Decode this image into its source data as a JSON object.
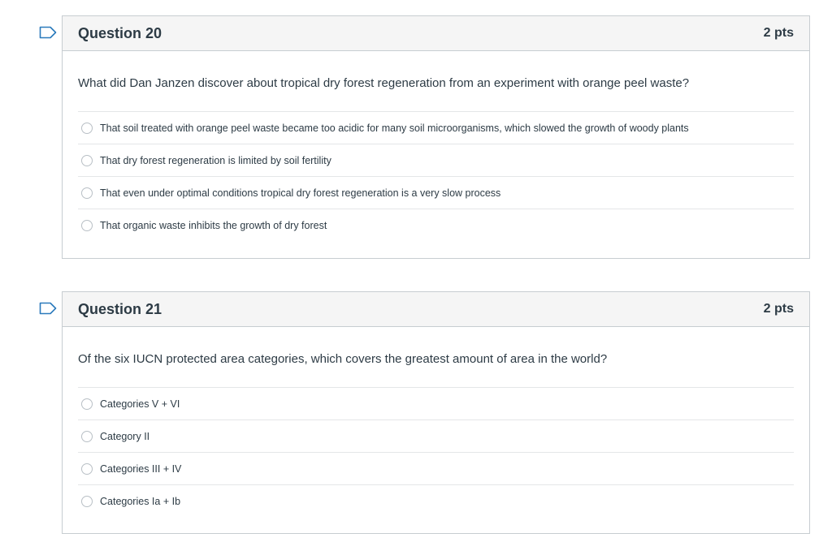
{
  "questions": [
    {
      "title": "Question 20",
      "points": "2 pts",
      "text": "What did Dan Janzen discover about tropical dry forest regeneration from an experiment with orange peel waste?",
      "answers": [
        "That soil treated with orange peel waste became too acidic for many soil microorganisms, which slowed the growth of woody plants",
        "That dry forest regeneration is limited by soil fertility",
        "That even under optimal conditions tropical dry forest regeneration is a very slow process",
        "That organic waste inhibits the growth of dry forest"
      ]
    },
    {
      "title": "Question 21",
      "points": "2 pts",
      "text": "Of the six IUCN protected area categories, which covers the greatest amount of area in the world?",
      "answers": [
        "Categories V + VI",
        "Category II",
        "Categories III + IV",
        "Categories Ia + Ib"
      ]
    }
  ],
  "colors": {
    "flag_stroke": "#2b7abc",
    "border": "#c7cdd1",
    "header_bg": "#f5f5f5",
    "text": "#2d3b45"
  },
  "icons": {
    "flag": "flag-question-icon",
    "radio": "radio-unselected-icon"
  }
}
